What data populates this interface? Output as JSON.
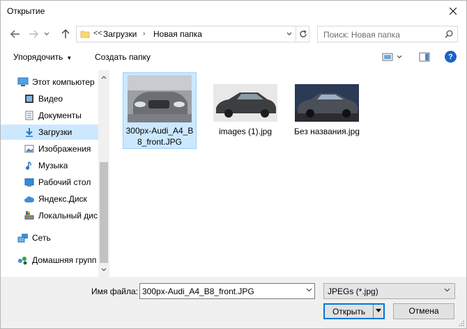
{
  "window": {
    "title": "Открытие"
  },
  "nav": {
    "back_icon": "arrow-left-icon",
    "forward_icon": "arrow-right-icon",
    "recent_icon": "chevron-down-icon",
    "up_icon": "arrow-up-icon"
  },
  "address": {
    "overflow": "<<",
    "crumbs": [
      "Загрузки",
      "Новая папка"
    ]
  },
  "search": {
    "placeholder": "Поиск: Новая папка"
  },
  "toolbar": {
    "organize_label": "Упорядочить",
    "new_folder_label": "Создать папку"
  },
  "sidebar": {
    "items": [
      {
        "label": "Этот компьютер",
        "icon": "computer-icon"
      },
      {
        "label": "Видео",
        "icon": "video-icon"
      },
      {
        "label": "Документы",
        "icon": "documents-icon"
      },
      {
        "label": "Загрузки",
        "icon": "downloads-icon",
        "selected": true
      },
      {
        "label": "Изображения",
        "icon": "pictures-icon"
      },
      {
        "label": "Музыка",
        "icon": "music-icon"
      },
      {
        "label": "Рабочий стол",
        "icon": "desktop-icon"
      },
      {
        "label": "Яндекс.Диск",
        "icon": "cloud-icon"
      },
      {
        "label": "Локальный дис",
        "icon": "drive-icon"
      },
      {
        "label": "Сеть",
        "icon": "network-icon"
      },
      {
        "label": "Домашняя групп",
        "icon": "homegroup-icon"
      }
    ]
  },
  "files": [
    {
      "name": "300px-Audi_A4_B8_front.JPG",
      "name_line1": "300px-Audi_A4_B",
      "name_line2": "8_front.JPG",
      "selected": true
    },
    {
      "name": "images (1).jpg",
      "selected": false
    },
    {
      "name": "Без названия.jpg",
      "selected": false
    }
  ],
  "bottom": {
    "filename_label": "Имя файла:",
    "filename_value": "300px-Audi_A4_B8_front.JPG",
    "filetype_value": "JPEGs (*.jpg)",
    "open_label": "Открыть",
    "cancel_label": "Отмена"
  },
  "colors": {
    "selection": "#cce8ff",
    "accent": "#0078d7",
    "help": "#1a63c7"
  }
}
